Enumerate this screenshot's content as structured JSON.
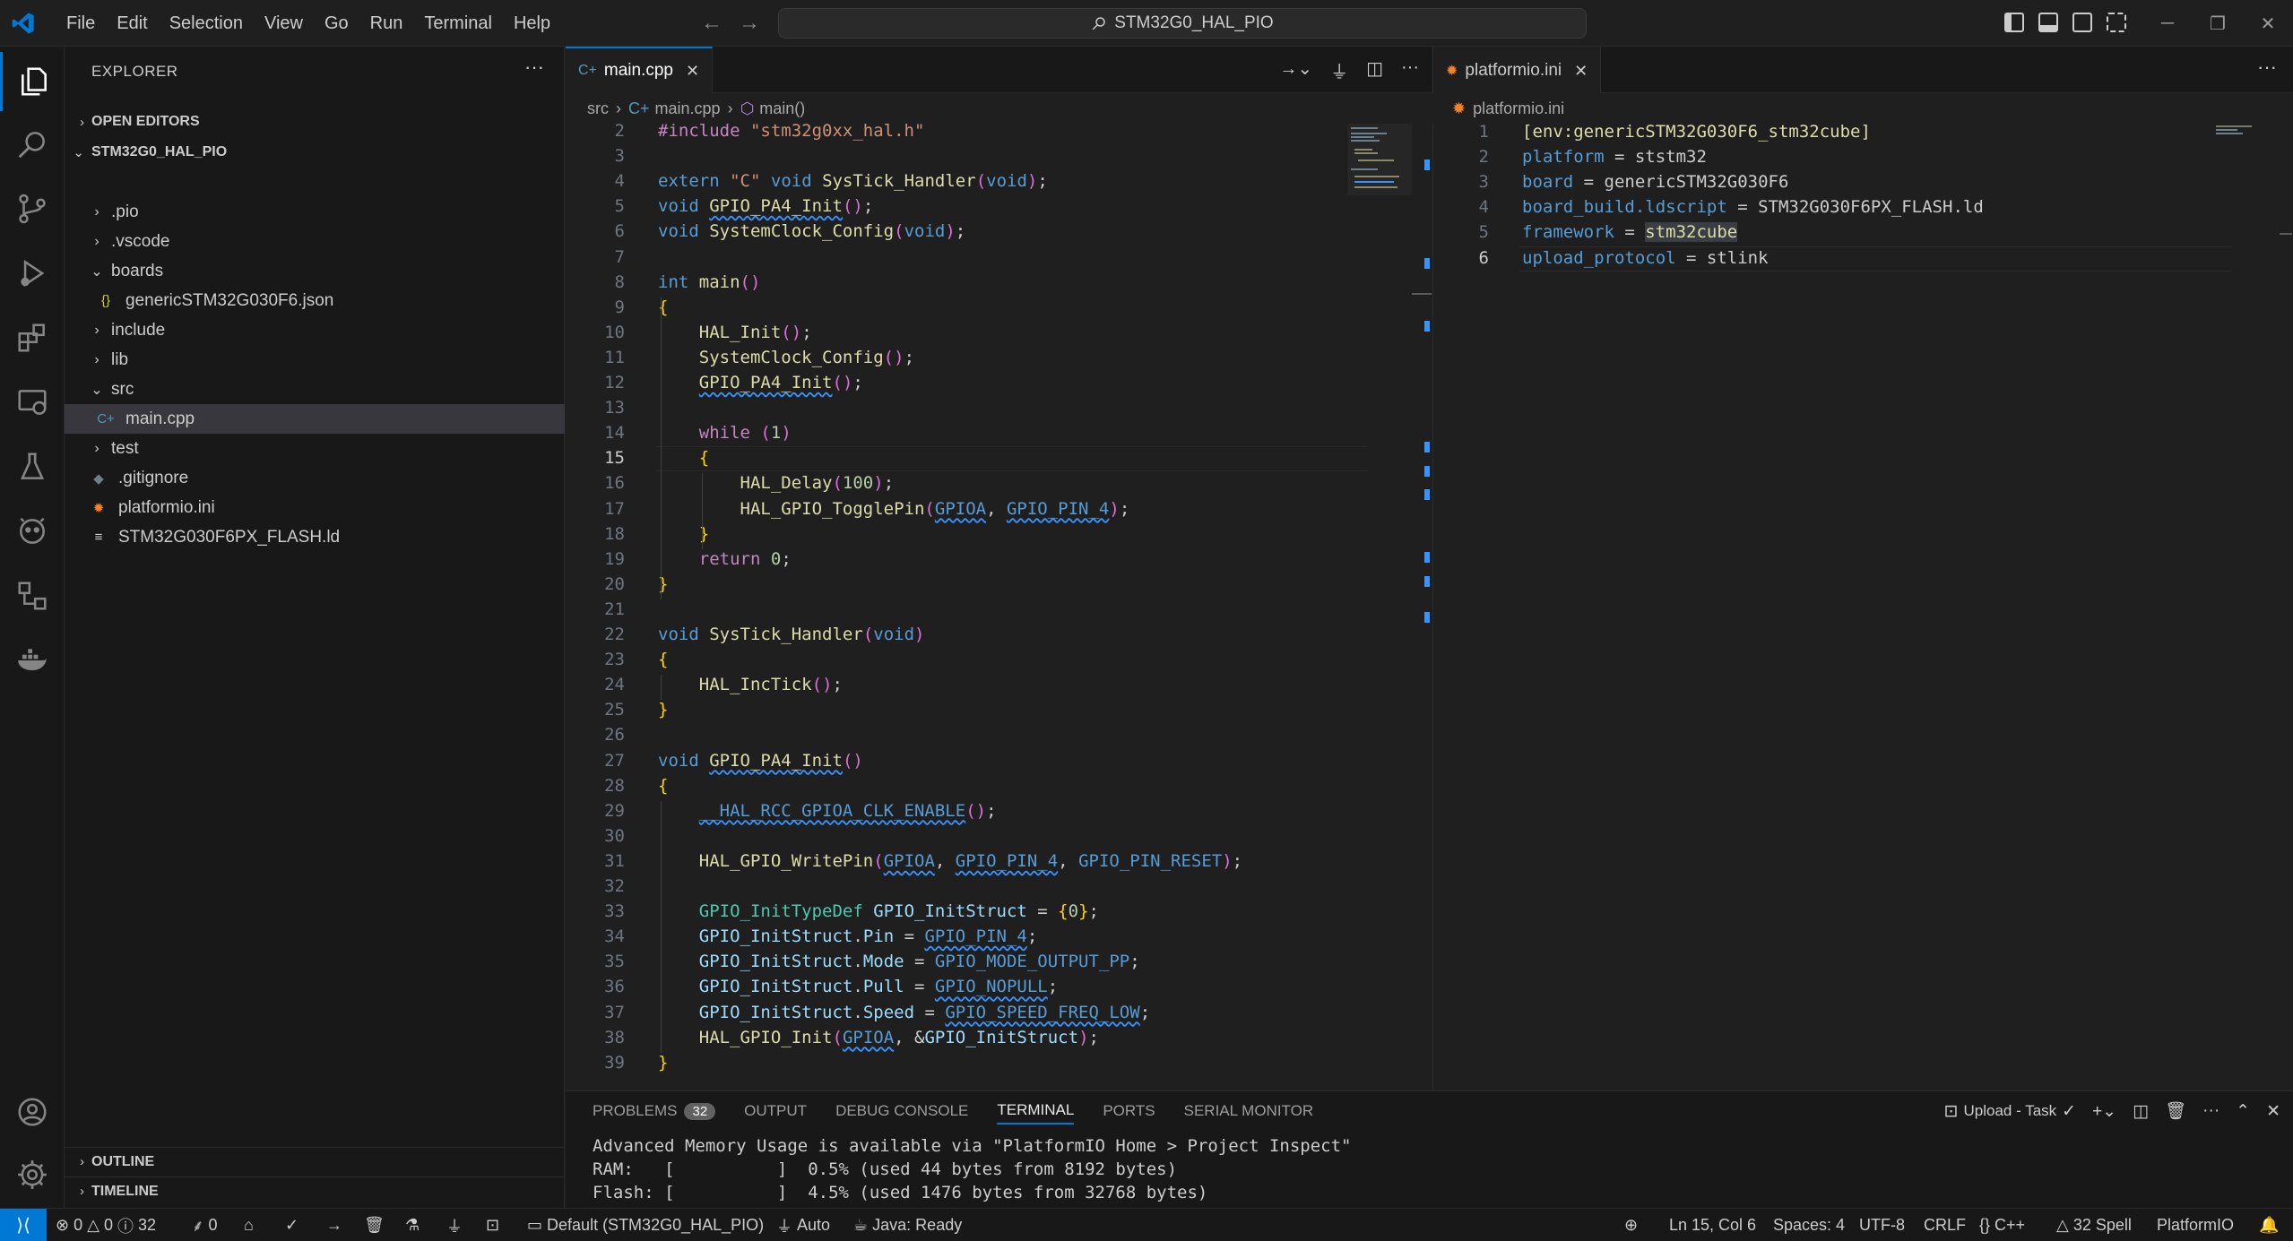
{
  "titlebar": {
    "menu": [
      "File",
      "Edit",
      "Selection",
      "View",
      "Go",
      "Run",
      "Terminal",
      "Help"
    ],
    "search": "STM32G0_HAL_PIO"
  },
  "sidebar": {
    "title": "EXPLORER",
    "open_editors": "OPEN EDITORS",
    "project": "STM32G0_HAL_PIO",
    "tree": [
      {
        "label": ".pio",
        "type": "folder",
        "open": false,
        "depth": 1
      },
      {
        "label": ".vscode",
        "type": "folder",
        "open": false,
        "depth": 1
      },
      {
        "label": "boards",
        "type": "folder",
        "open": true,
        "depth": 1
      },
      {
        "label": "genericSTM32G030F6.json",
        "type": "json",
        "depth": 2
      },
      {
        "label": "include",
        "type": "folder",
        "open": false,
        "depth": 1
      },
      {
        "label": "lib",
        "type": "folder",
        "open": false,
        "depth": 1
      },
      {
        "label": "src",
        "type": "folder",
        "open": true,
        "depth": 1
      },
      {
        "label": "main.cpp",
        "type": "cpp",
        "depth": 2,
        "selected": true
      },
      {
        "label": "test",
        "type": "folder",
        "open": false,
        "depth": 1
      },
      {
        "label": ".gitignore",
        "type": "git",
        "depth": 1
      },
      {
        "label": "platformio.ini",
        "type": "pio",
        "depth": 1
      },
      {
        "label": "STM32G030F6PX_FLASH.ld",
        "type": "text",
        "depth": 1
      }
    ],
    "outline": "OUTLINE",
    "timeline": "TIMELINE"
  },
  "editor1": {
    "tab_label": "main.cpp",
    "breadcrumb": [
      "src",
      "main.cpp",
      "main()"
    ],
    "current_line": 15,
    "lines": [
      {
        "n": 2,
        "code": "#include \"stm32g0xx_hal.h\""
      },
      {
        "n": 3,
        "code": ""
      },
      {
        "n": 4,
        "code": "extern \"C\" void SysTick_Handler(void);"
      },
      {
        "n": 5,
        "code": "void GPIO_PA4_Init();"
      },
      {
        "n": 6,
        "code": "void SystemClock_Config(void);"
      },
      {
        "n": 7,
        "code": ""
      },
      {
        "n": 8,
        "code": "int main()"
      },
      {
        "n": 9,
        "code": "{"
      },
      {
        "n": 10,
        "code": "    HAL_Init();"
      },
      {
        "n": 11,
        "code": "    SystemClock_Config();"
      },
      {
        "n": 12,
        "code": "    GPIO_PA4_Init();"
      },
      {
        "n": 13,
        "code": ""
      },
      {
        "n": 14,
        "code": "    while (1)"
      },
      {
        "n": 15,
        "code": "    {"
      },
      {
        "n": 16,
        "code": "        HAL_Delay(100);"
      },
      {
        "n": 17,
        "code": "        HAL_GPIO_TogglePin(GPIOA, GPIO_PIN_4);"
      },
      {
        "n": 18,
        "code": "    }"
      },
      {
        "n": 19,
        "code": "    return 0;"
      },
      {
        "n": 20,
        "code": "}"
      },
      {
        "n": 21,
        "code": ""
      },
      {
        "n": 22,
        "code": "void SysTick_Handler(void)"
      },
      {
        "n": 23,
        "code": "{"
      },
      {
        "n": 24,
        "code": "    HAL_IncTick();"
      },
      {
        "n": 25,
        "code": "}"
      },
      {
        "n": 26,
        "code": ""
      },
      {
        "n": 27,
        "code": "void GPIO_PA4_Init()"
      },
      {
        "n": 28,
        "code": "{"
      },
      {
        "n": 29,
        "code": "    __HAL_RCC_GPIOA_CLK_ENABLE();"
      },
      {
        "n": 30,
        "code": ""
      },
      {
        "n": 31,
        "code": "    HAL_GPIO_WritePin(GPIOA, GPIO_PIN_4, GPIO_PIN_RESET);"
      },
      {
        "n": 32,
        "code": ""
      },
      {
        "n": 33,
        "code": "    GPIO_InitTypeDef GPIO_InitStruct = {0};"
      },
      {
        "n": 34,
        "code": "    GPIO_InitStruct.Pin = GPIO_PIN_4;"
      },
      {
        "n": 35,
        "code": "    GPIO_InitStruct.Mode = GPIO_MODE_OUTPUT_PP;"
      },
      {
        "n": 36,
        "code": "    GPIO_InitStruct.Pull = GPIO_NOPULL;"
      },
      {
        "n": 37,
        "code": "    GPIO_InitStruct.Speed = GPIO_SPEED_FREQ_LOW;"
      },
      {
        "n": 38,
        "code": "    HAL_GPIO_Init(GPIOA, &GPIO_InitStruct);"
      },
      {
        "n": 39,
        "code": "}"
      }
    ]
  },
  "editor2": {
    "tab_label": "platformio.ini",
    "breadcrumb": [
      "platformio.ini"
    ],
    "current_line": 6,
    "lines": [
      {
        "n": 1,
        "code": "[env:genericSTM32G030F6_stm32cube]"
      },
      {
        "n": 2,
        "code": "platform = ststm32"
      },
      {
        "n": 3,
        "code": "board = genericSTM32G030F6"
      },
      {
        "n": 4,
        "code": "board_build.ldscript = STM32G030F6PX_FLASH.ld"
      },
      {
        "n": 5,
        "code": "framework = stm32cube"
      },
      {
        "n": 6,
        "code": "upload_protocol = stlink"
      }
    ]
  },
  "panel": {
    "tabs": [
      "PROBLEMS",
      "OUTPUT",
      "DEBUG CONSOLE",
      "TERMINAL",
      "PORTS",
      "SERIAL MONITOR"
    ],
    "problems_count": "32",
    "active_tab": "TERMINAL",
    "task_label": "Upload - Task",
    "terminal_lines": [
      "Advanced Memory Usage is available via \"PlatformIO Home > Project Inspect\"",
      "RAM:   [          ]  0.5% (used 44 bytes from 8192 bytes)",
      "Flash: [          ]  4.5% (used 1476 bytes from 32768 bytes)"
    ]
  },
  "statusbar": {
    "errors": "0",
    "warnings": "0",
    "infos": "32",
    "ports": "0",
    "env": "Default (STM32G0_HAL_PIO)",
    "auto": "Auto",
    "java": "Java: Ready",
    "position": "Ln 15, Col 6",
    "spaces": "Spaces: 4",
    "encoding": "UTF-8",
    "eol": "CRLF",
    "language": "C++",
    "spell": "32 Spell",
    "platformio": "PlatformIO"
  },
  "colors": {
    "accent": "#0078d4",
    "editor_bg": "#1f1f1f",
    "sidebar_bg": "#181818"
  }
}
